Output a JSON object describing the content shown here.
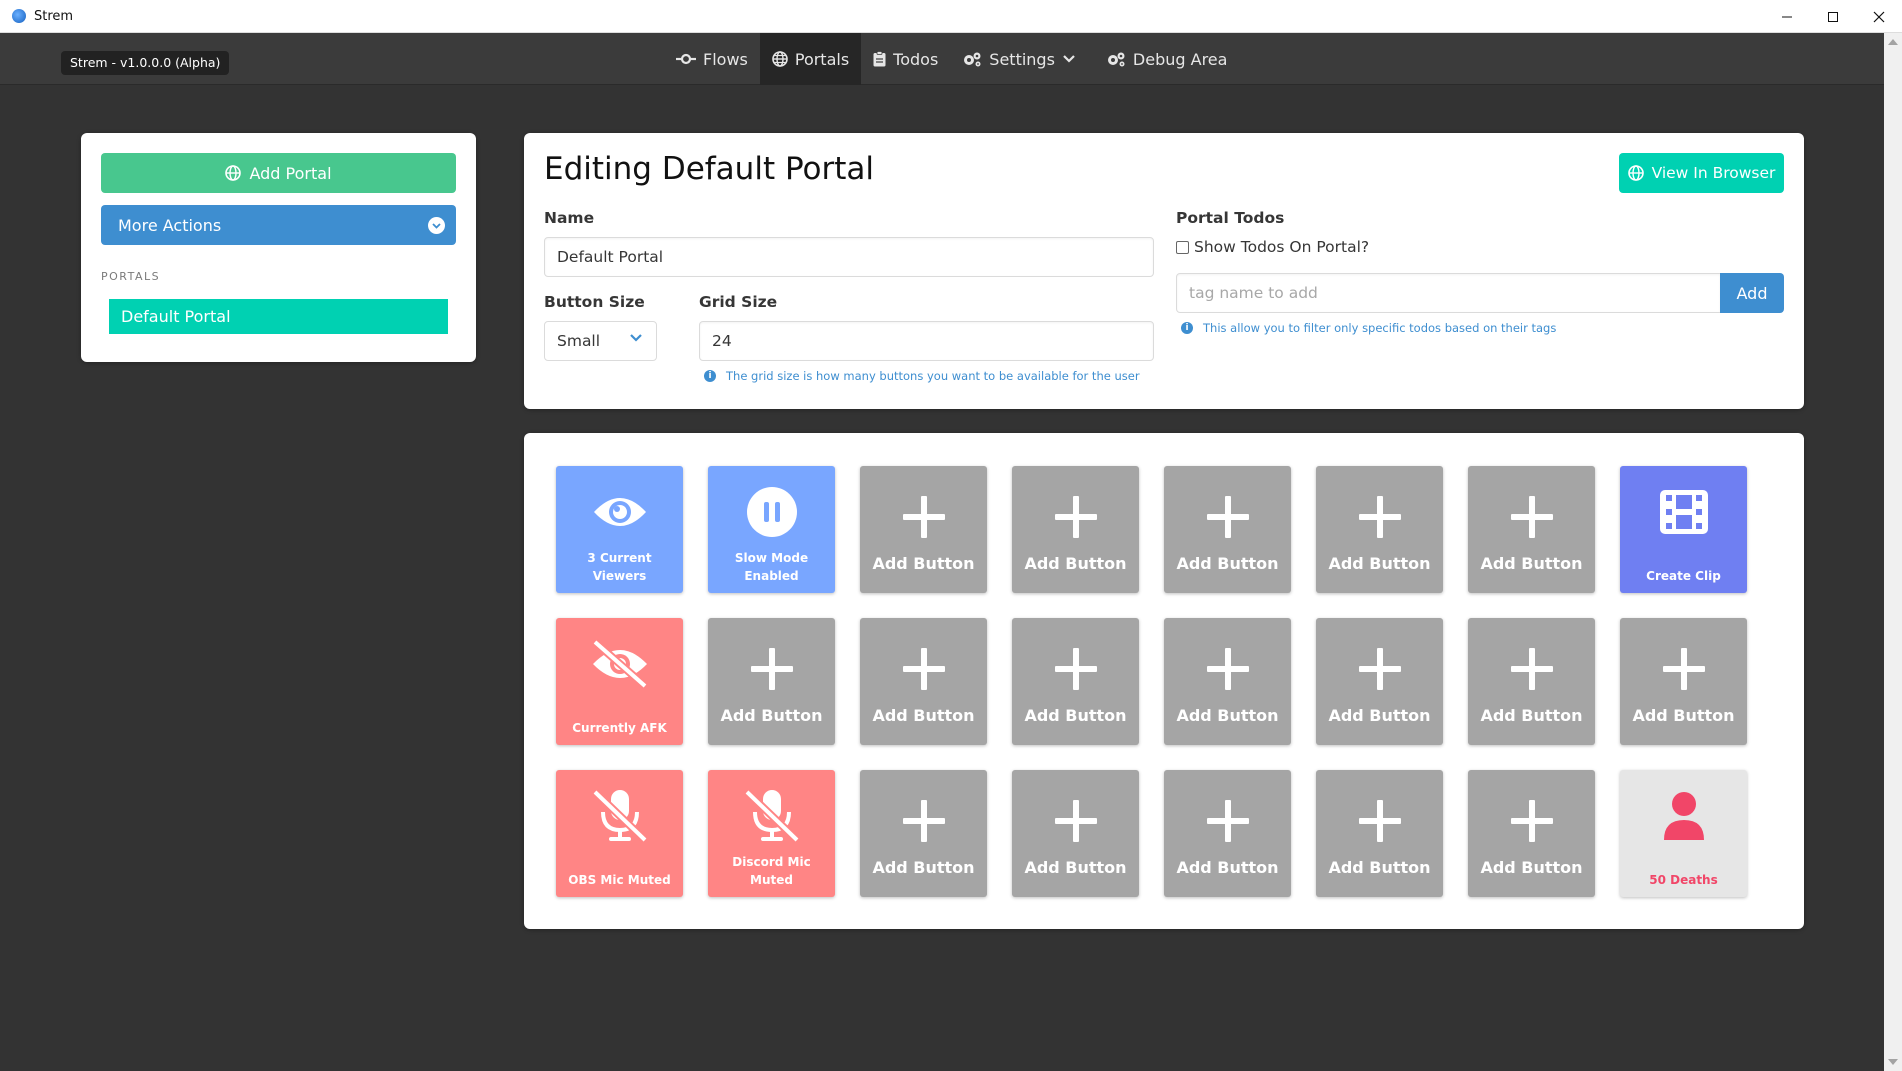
{
  "window": {
    "title": "Strem",
    "controls": [
      "minimize",
      "maximize",
      "close"
    ]
  },
  "navbar": {
    "version": "Strem - v1.0.0.0 (Alpha)",
    "items": [
      {
        "label": "Flows",
        "icon": "flow-icon"
      },
      {
        "label": "Portals",
        "icon": "globe-icon",
        "active": true
      },
      {
        "label": "Todos",
        "icon": "clipboard-icon"
      },
      {
        "label": "Settings",
        "icon": "gears-icon",
        "dropdown": true
      },
      {
        "label": "Debug Area",
        "icon": "gears-icon"
      }
    ]
  },
  "sidebar": {
    "add_portal": "Add Portal",
    "more_actions": "More Actions",
    "section_label": "PORTALS",
    "portals": [
      "Default Portal"
    ]
  },
  "editor": {
    "title": "Editing Default Portal",
    "view_in_browser": "View In Browser",
    "name_label": "Name",
    "name_value": "Default Portal",
    "button_size_label": "Button Size",
    "button_size_value": "Small",
    "grid_size_label": "Grid Size",
    "grid_size_value": "24",
    "grid_help": "The grid size is how many buttons you want to be available for the user",
    "todos_label": "Portal Todos",
    "show_todos_label": "Show Todos On Portal?",
    "tag_placeholder": "tag name to add",
    "add_tag": "Add",
    "tag_help": "This allow you to filter only specific todos based on their tags"
  },
  "grid": {
    "tiles": [
      {
        "type": "blue",
        "icon": "eye-icon",
        "label": "3 Current Viewers"
      },
      {
        "type": "blue",
        "icon": "pause-circle-icon",
        "label": "Slow Mode Enabled"
      },
      {
        "type": "empty",
        "label": "Add Button"
      },
      {
        "type": "empty",
        "label": "Add Button"
      },
      {
        "type": "empty",
        "label": "Add Button"
      },
      {
        "type": "empty",
        "label": "Add Button"
      },
      {
        "type": "empty",
        "label": "Add Button"
      },
      {
        "type": "purple",
        "icon": "film-icon",
        "label": "Create Clip"
      },
      {
        "type": "red",
        "icon": "eye-slash-icon",
        "label": "Currently AFK"
      },
      {
        "type": "empty",
        "label": "Add Button"
      },
      {
        "type": "empty",
        "label": "Add Button"
      },
      {
        "type": "empty",
        "label": "Add Button"
      },
      {
        "type": "empty",
        "label": "Add Button"
      },
      {
        "type": "empty",
        "label": "Add Button"
      },
      {
        "type": "empty",
        "label": "Add Button"
      },
      {
        "type": "empty",
        "label": "Add Button"
      },
      {
        "type": "red",
        "icon": "mic-slash-icon",
        "label": "OBS Mic Muted"
      },
      {
        "type": "red",
        "icon": "mic-slash-icon",
        "label": "Discord Mic Muted"
      },
      {
        "type": "empty",
        "label": "Add Button"
      },
      {
        "type": "empty",
        "label": "Add Button"
      },
      {
        "type": "empty",
        "label": "Add Button"
      },
      {
        "type": "empty",
        "label": "Add Button"
      },
      {
        "type": "empty",
        "label": "Add Button"
      },
      {
        "type": "light",
        "icon": "user-icon",
        "label": "50 Deaths"
      }
    ]
  },
  "colors": {
    "success": "#48c78e",
    "info": "#3e8ed0",
    "primary": "#00d1b2",
    "tile_blue": "#79a6ff",
    "tile_purple": "#6f7ff2",
    "tile_red": "#ff8585",
    "tile_empty": "#a5a5a5",
    "danger_text": "#f14668"
  }
}
